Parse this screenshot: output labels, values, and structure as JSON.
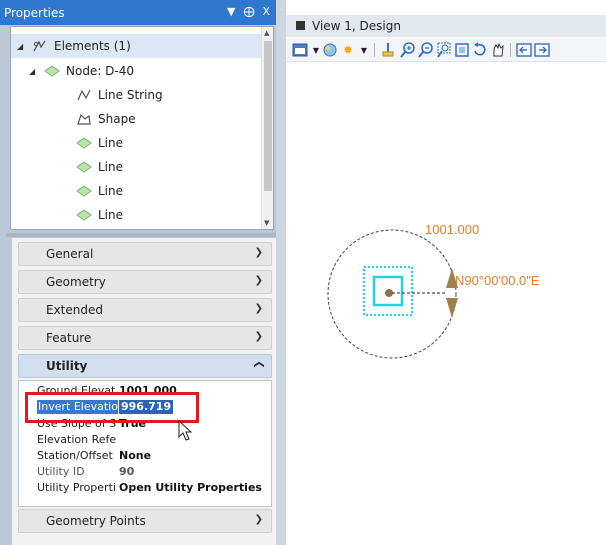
{
  "panel": {
    "title": "Properties",
    "title_icons": [
      "dropdown-arrow-icon",
      "pin-icon",
      "close-icon"
    ],
    "pin_glyph": "⨁",
    "close_glyph": "X"
  },
  "tree": {
    "items": [
      {
        "label": "Elements (1)",
        "icon": "elements-icon",
        "expanded": true,
        "selected": true
      },
      {
        "label": "Node: D-40",
        "icon": "node-diamond-icon",
        "expanded": true
      },
      {
        "label": "Line String",
        "icon": "line-string-icon"
      },
      {
        "label": "Shape",
        "icon": "shape-icon"
      },
      {
        "label": "Line",
        "icon": "line-diamond-icon"
      },
      {
        "label": "Line",
        "icon": "line-diamond-icon"
      },
      {
        "label": "Line",
        "icon": "line-diamond-icon"
      },
      {
        "label": "Line",
        "icon": "line-diamond-icon"
      }
    ]
  },
  "sections": {
    "general": "General",
    "geometry": "Geometry",
    "extended": "Extended",
    "feature": "Feature",
    "utility": "Utility",
    "geometry_points": "Geometry Points"
  },
  "utility_props": [
    {
      "label": "Ground Elevat",
      "value": "1001.000"
    },
    {
      "label": "Invert Elevatio",
      "value": "996.719"
    },
    {
      "label": "Use Slope of S",
      "value": "True"
    },
    {
      "label": "Elevation Refe",
      "value": ""
    },
    {
      "label": "Station/Offset I",
      "value": "None"
    },
    {
      "label": "Utility ID",
      "value": "90"
    },
    {
      "label": "Utility Properti",
      "value": "Open Utility Properties"
    }
  ],
  "view": {
    "title": "View 1, Design",
    "toolbar_icons": [
      "view-attributes-icon",
      "dropdown-icon",
      "display-style-icon",
      "lighting-icon",
      "dropdown-icon",
      "update-view-icon",
      "zoom-in-icon",
      "zoom-out-icon",
      "window-area-icon",
      "fit-view-icon",
      "rotate-view-icon",
      "pan-view-icon",
      "view-previous-icon",
      "view-next-icon"
    ],
    "elevation_label": "1001.000",
    "bearing_label": "N90°00'00.0\"E"
  },
  "colors": {
    "titlebar": "#2f78cf",
    "selection": "#3a78d0",
    "highlight_box": "#e01a1a",
    "annotation": "#e07d2c",
    "node_square": "#22d3e0",
    "node_center": "#9a6a4a"
  }
}
